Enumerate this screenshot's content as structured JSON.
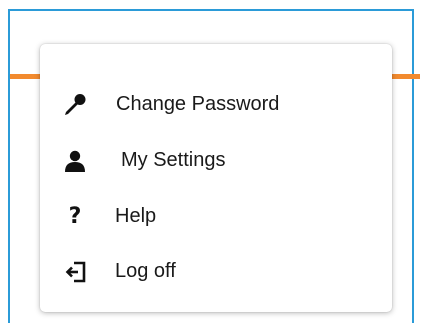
{
  "menu": {
    "items": [
      {
        "label": "Change Password",
        "icon": "key-icon"
      },
      {
        "label": "My Settings",
        "icon": "user-icon"
      },
      {
        "label": "Help",
        "icon": "question-icon",
        "glyph": "?"
      },
      {
        "label": "Log off",
        "icon": "logout-icon"
      }
    ]
  },
  "colors": {
    "frame_border": "#2b9bd8",
    "accent": "#f28a2e",
    "icon": "#111111",
    "text": "#1a1a1a"
  }
}
